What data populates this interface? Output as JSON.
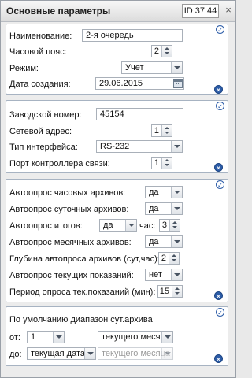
{
  "header": {
    "title": "Основные параметры",
    "id_label": "ID 37.44",
    "close_glyph": "×"
  },
  "icons": {
    "ok": "✓",
    "delete": "×"
  },
  "general": {
    "name_label": "Наименование:",
    "name_value": "2-я очередь",
    "tz_label": "Часовой пояс:",
    "tz_value": "2",
    "mode_label": "Режим:",
    "mode_value": "Учет",
    "date_label": "Дата создания:",
    "date_value": "29.06.2015"
  },
  "device": {
    "serial_label": "Заводской номер:",
    "serial_value": "45154",
    "net_label": "Сетевой адрес:",
    "net_value": "1",
    "iface_label": "Тип интерфейса:",
    "iface_value": "RS-232",
    "port_label": "Порт контроллера связи:",
    "port_value": "1"
  },
  "autopoll": {
    "hourly_label": "Автоопрос часовых архивов:",
    "hourly_value": "да",
    "daily_label": "Автоопрос суточных архивов:",
    "daily_value": "да",
    "totals_label": "Автоопрос итогов:",
    "totals_value": "да",
    "hour_label": "час:",
    "hour_value": "3",
    "monthly_label": "Автоопрос месячных архивов:",
    "monthly_value": "да",
    "depth_label": "Глубина автопроса архивов (сут,час):",
    "depth_value": "2",
    "current_label": "Автоопрос текущих показаний:",
    "current_value": "нет",
    "period_label": "Период опроса тек.показаний (мин):",
    "period_value": "15"
  },
  "range": {
    "heading": "По умолчанию диапазон сут.архива",
    "from_label": "от:",
    "from_num": "1",
    "from_unit": "текущего месяца",
    "to_label": "до:",
    "to_value": "текущая дата",
    "to_unit": "текущего месяца"
  }
}
